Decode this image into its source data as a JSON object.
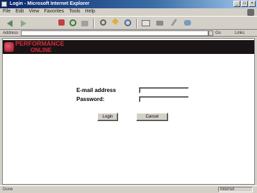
{
  "window": {
    "title": "Login - Microsoft Internet Explorer"
  },
  "menubar": {
    "items": [
      "File",
      "Edit",
      "View",
      "Favorites",
      "Tools",
      "Help"
    ]
  },
  "toolbar": {
    "buttons": [
      {
        "name": "back",
        "icon": "back-arrow-icon"
      },
      {
        "name": "forward",
        "icon": "forward-arrow-icon"
      },
      {
        "name": "stop",
        "icon": "stop-icon"
      },
      {
        "name": "refresh",
        "icon": "refresh-icon"
      },
      {
        "name": "home",
        "icon": "home-icon"
      },
      {
        "name": "search",
        "icon": "search-icon"
      },
      {
        "name": "favorites",
        "icon": "favorites-icon"
      },
      {
        "name": "history",
        "icon": "history-icon"
      },
      {
        "name": "mail",
        "icon": "mail-icon"
      },
      {
        "name": "print",
        "icon": "print-icon"
      },
      {
        "name": "edit",
        "icon": "edit-icon"
      },
      {
        "name": "discuss",
        "icon": "discuss-icon"
      }
    ]
  },
  "addressbar": {
    "label": "Address",
    "value": "",
    "go_label": "Go",
    "links_label": "Links"
  },
  "banner": {
    "brand_line1": "PERFORMANCE",
    "brand_line2": "ONLINE"
  },
  "form": {
    "email_label": "E-mail address",
    "email_value": "",
    "password_label": "Password:",
    "password_value": "",
    "login_button": "Login",
    "cancel_button": "Cancel"
  },
  "statusbar": {
    "text": "Done",
    "zone": "Internet"
  }
}
